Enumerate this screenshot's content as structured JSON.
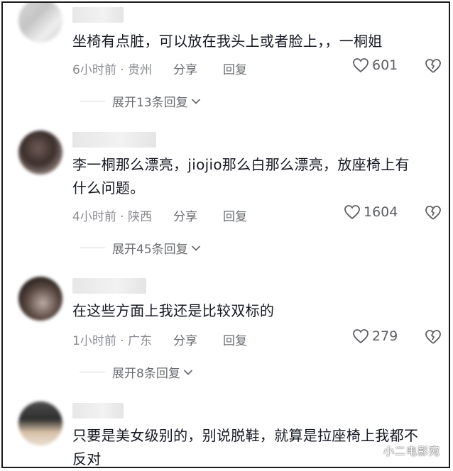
{
  "comments": [
    {
      "text": "坐椅有点脏，可以放在我头上或者脸上，，一桐姐",
      "time": "6小时前 · 贵州",
      "share_label": "分享",
      "reply_label": "回复",
      "likes": "601",
      "expand_label": "展开13条回复"
    },
    {
      "text": "李一桐那么漂亮，jiojio那么白那么漂亮，放座椅上有什么问题。",
      "time": "4小时前 · 陕西",
      "share_label": "分享",
      "reply_label": "回复",
      "likes": "1604",
      "expand_label": "展开45条回复"
    },
    {
      "text": "在这些方面上我还是比较双标的",
      "time": "1小时前 · 广东",
      "share_label": "分享",
      "reply_label": "回复",
      "likes": "279",
      "expand_label": "展开8条回复"
    },
    {
      "text": "只要是美女级别的，别说脱鞋，就算是拉座椅上我都不反对"
    }
  ],
  "watermark": "小二电影宛",
  "colors": {
    "text": "#161823",
    "meta": "#8a8b91",
    "action": "#6b6c72",
    "divider": "#d7d8da"
  }
}
